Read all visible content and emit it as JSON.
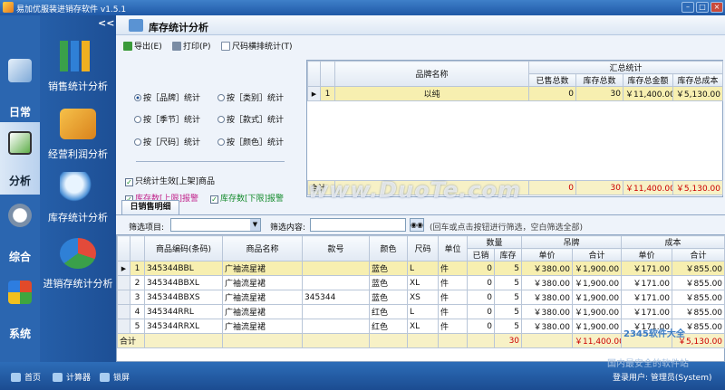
{
  "window": {
    "title": "易加优服装进销存软件 v1.5.1"
  },
  "nav": {
    "collapse": "<<",
    "tabs": [
      {
        "label": "日常"
      },
      {
        "label": "分析"
      },
      {
        "label": "综合"
      },
      {
        "label": "系统"
      }
    ],
    "menu": [
      {
        "label": "销售统计分析"
      },
      {
        "label": "经营利润分析"
      },
      {
        "label": "库存统计分析"
      },
      {
        "label": "进销存统计分析"
      }
    ]
  },
  "page": {
    "title": "库存统计分析"
  },
  "toolbar": {
    "export": "导出(E)",
    "print": "打印(P)",
    "size_sort": "尺码横排统计(T)"
  },
  "options": {
    "radios": [
      "按［品牌］统计",
      "按［类别］统计",
      "按［季节］统计",
      "按［款式］统计",
      "按［尺码］统计",
      "按［颜色］统计"
    ],
    "selected": 0,
    "only_on_shelf": "只统计生效[上架]商品",
    "upper_alert": "库存数[上限]报警",
    "lower_alert": "库存数[下限]报警"
  },
  "summary": {
    "headers": {
      "brand": "品牌名称",
      "group": "汇总统计",
      "sold": "已售总数",
      "stock": "库存总数",
      "amount": "库存总金额",
      "cost": "库存总成本"
    },
    "rows": [
      {
        "idx": "1",
        "brand": "以纯",
        "sold": "0",
        "stock": "30",
        "amount": "￥11,400.00",
        "cost": "￥5,130.00"
      }
    ],
    "footer": {
      "label": "合计",
      "sold": "0",
      "stock": "30",
      "amount": "￥11,400.00",
      "cost": "￥5,130.00"
    }
  },
  "section2": {
    "tab": "日销售明细",
    "filter_item_label": "筛选项目:",
    "filter_content_label": "筛选内容:",
    "hint": "(回车或点击按钮进行筛选，空白筛选全部)"
  },
  "detail": {
    "headers": {
      "code": "商品编码(条码)",
      "name": "商品名称",
      "style": "款号",
      "color": "颜色",
      "size": "尺码",
      "unit": "单位",
      "qty": "数量",
      "sold": "已销",
      "stock": "库存",
      "tag": "吊牌",
      "tag_unit": "单价",
      "tag_total": "合计",
      "cost": "成本",
      "cost_unit": "单价",
      "cost_total": "合计"
    },
    "rows": [
      {
        "idx": "1",
        "code": "345344BBL",
        "name": "广袖流星裙",
        "style": "",
        "color": "蓝色",
        "size": "L",
        "unit": "件",
        "sold": "0",
        "stock": "5",
        "tag_unit": "￥380.00",
        "tag_total": "￥1,900.00",
        "cost_unit": "￥171.00",
        "cost_total": "￥855.00"
      },
      {
        "idx": "2",
        "code": "345344BBXL",
        "name": "广袖流星裙",
        "style": "",
        "color": "蓝色",
        "size": "XL",
        "unit": "件",
        "sold": "0",
        "stock": "5",
        "tag_unit": "￥380.00",
        "tag_total": "￥1,900.00",
        "cost_unit": "￥171.00",
        "cost_total": "￥855.00"
      },
      {
        "idx": "3",
        "code": "345344BBXS",
        "name": "广袖流星裙",
        "style": "345344",
        "color": "蓝色",
        "size": "XS",
        "unit": "件",
        "sold": "0",
        "stock": "5",
        "tag_unit": "￥380.00",
        "tag_total": "￥1,900.00",
        "cost_unit": "￥171.00",
        "cost_total": "￥855.00"
      },
      {
        "idx": "4",
        "code": "345344RRL",
        "name": "广袖流星裙",
        "style": "",
        "color": "红色",
        "size": "L",
        "unit": "件",
        "sold": "0",
        "stock": "5",
        "tag_unit": "￥380.00",
        "tag_total": "￥1,900.00",
        "cost_unit": "￥171.00",
        "cost_total": "￥855.00"
      },
      {
        "idx": "5",
        "code": "345344RRXL",
        "name": "广袖流星裙",
        "style": "",
        "color": "红色",
        "size": "XL",
        "unit": "件",
        "sold": "0",
        "stock": "5",
        "tag_unit": "￥380.00",
        "tag_total": "￥1,900.00",
        "cost_unit": "￥171.00",
        "cost_total": "￥855.00"
      }
    ],
    "footer": {
      "label": "合计",
      "stock": "30",
      "tag_total": "￥11,400.00",
      "cost_total": "￥5,130.00"
    }
  },
  "statusbar": {
    "home": "首页",
    "calc": "计算器",
    "lock": "锁屏",
    "user": "登录用户: 管理员(System)"
  },
  "watermarks": {
    "main": "www.DuoTe.com",
    "corner": "2345软件大全",
    "corner2": "国内最安全的软件站"
  }
}
